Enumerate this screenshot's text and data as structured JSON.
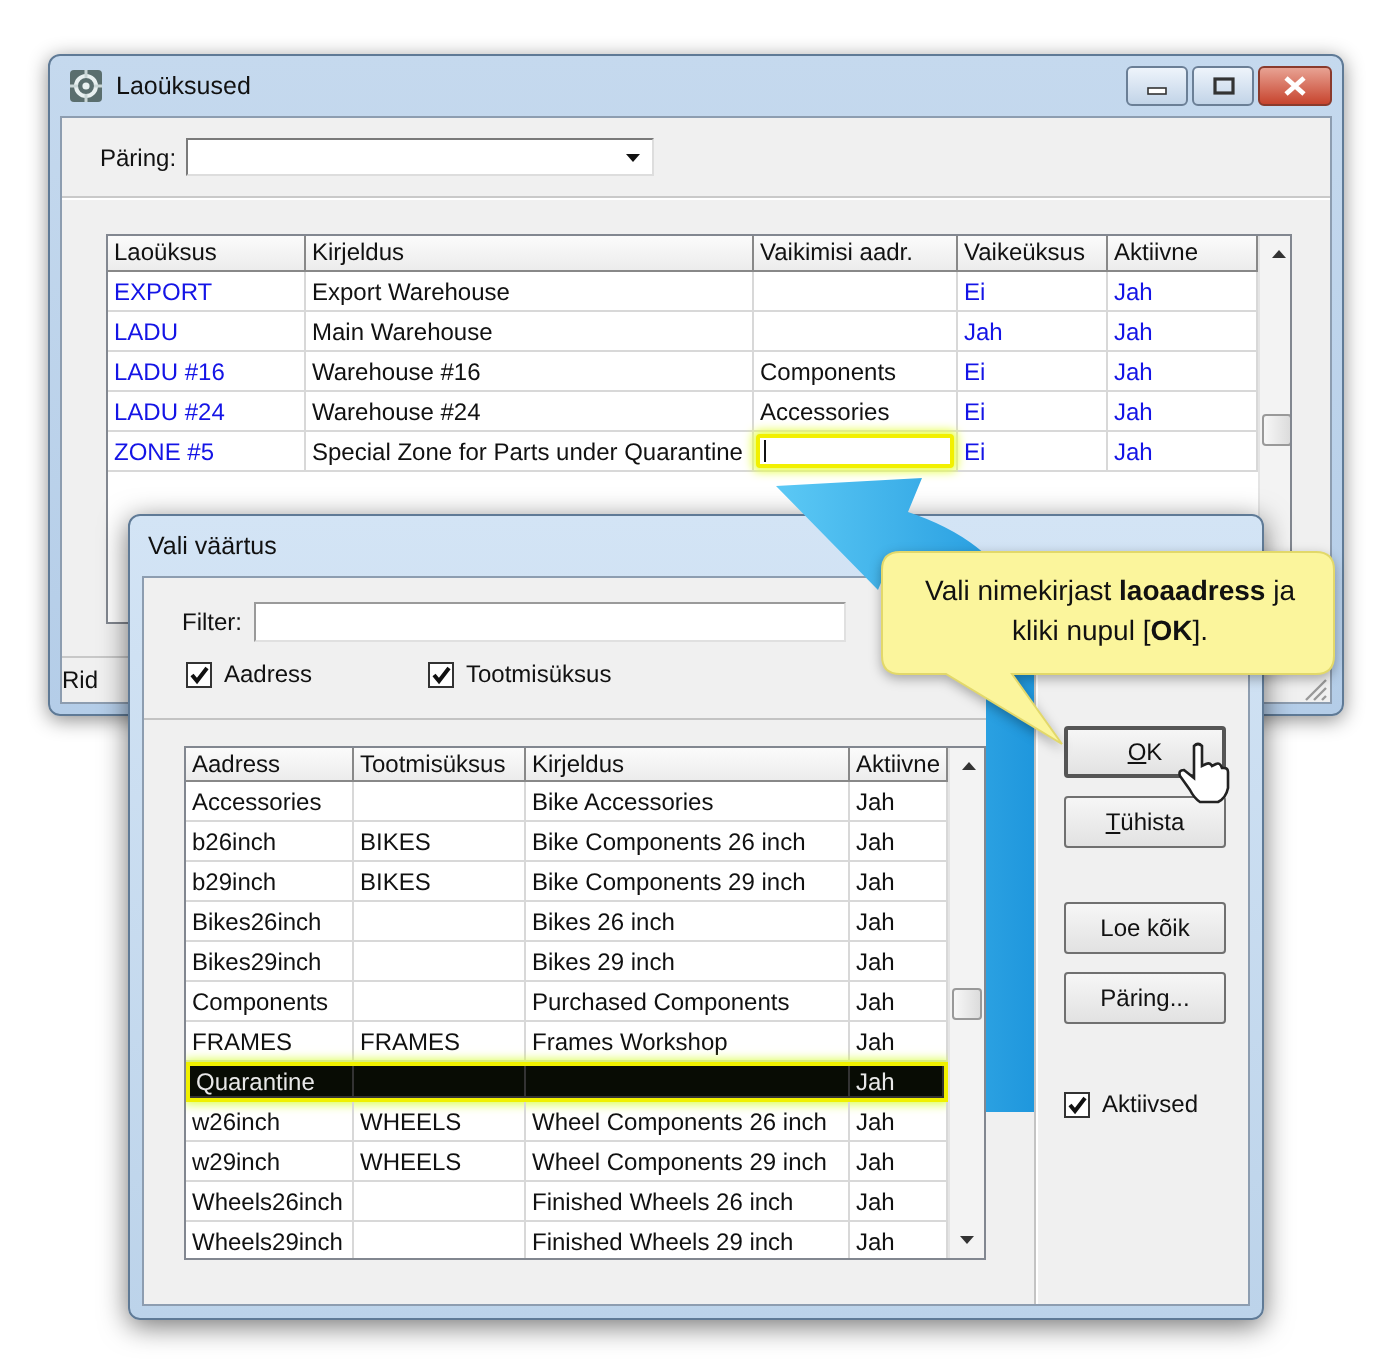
{
  "main_window": {
    "title": "Laoüksused",
    "query": {
      "label": "Päring:"
    },
    "table": {
      "columns": [
        {
          "label": "Laoüksus",
          "kind": "link"
        },
        {
          "label": "Kirjeldus",
          "kind": "text"
        },
        {
          "label": "Vaikimisi aadr.",
          "kind": "field"
        },
        {
          "label": "Vaikeüksus",
          "kind": "link"
        },
        {
          "label": "Aktiivne",
          "kind": "link"
        }
      ],
      "rows": [
        {
          "code": "EXPORT",
          "description": "Export Warehouse",
          "default_unit": "Ei",
          "active": "Jah",
          "editing": false
        },
        {
          "code": "LADU",
          "description": "Main Warehouse",
          "default_unit": "Jah",
          "active": "Jah",
          "editing": false
        },
        {
          "code": "LADU #16",
          "description": "Warehouse #16",
          "default_address": "Components",
          "default_unit": "Ei",
          "active": "Jah",
          "editing": false
        },
        {
          "code": "LADU #24",
          "description": "Warehouse #24",
          "default_address": "Accessories",
          "default_unit": "Ei",
          "active": "Jah",
          "editing": false
        },
        {
          "code": "ZONE #5",
          "description": "Special Zone for Parts under Quarantine",
          "default_unit": "Ei",
          "active": "Jah",
          "editing": true
        }
      ]
    },
    "status_bar": "Rid"
  },
  "dialog": {
    "title": "Vali väärtus",
    "filter": {
      "label": "Filter:"
    },
    "filter_options": [
      {
        "label": "Aadress",
        "checked": true
      },
      {
        "label": "Tootmisüksus",
        "checked": true
      }
    ],
    "table": {
      "columns": [
        {
          "label": "Aadress"
        },
        {
          "label": "Tootmisüksus"
        },
        {
          "label": "Kirjeldus"
        },
        {
          "label": "Aktiivne"
        }
      ],
      "rows": [
        {
          "address": "Accessories",
          "description": "Bike Accessories",
          "active": "Jah",
          "selected": false
        },
        {
          "address": "b26inch",
          "unit": "BIKES",
          "description": "Bike Components 26 inch",
          "active": "Jah",
          "selected": false
        },
        {
          "address": "b29inch",
          "unit": "BIKES",
          "description": "Bike Components 29 inch",
          "active": "Jah",
          "selected": false
        },
        {
          "address": "Bikes26inch",
          "description": "Bikes 26 inch",
          "active": "Jah",
          "selected": false
        },
        {
          "address": "Bikes29inch",
          "description": "Bikes 29 inch",
          "active": "Jah",
          "selected": false
        },
        {
          "address": "Components",
          "description": "Purchased Components",
          "active": "Jah",
          "selected": false
        },
        {
          "address": "FRAMES",
          "unit": "FRAMES",
          "description": "Frames Workshop",
          "active": "Jah",
          "selected": false
        },
        {
          "address": "Quarantine",
          "active": "Jah",
          "selected": true
        },
        {
          "address": "w26inch",
          "unit": "WHEELS",
          "description": "Wheel Components 26 inch",
          "active": "Jah",
          "selected": false
        },
        {
          "address": "w29inch",
          "unit": "WHEELS",
          "description": "Wheel Components 29 inch",
          "active": "Jah",
          "selected": false
        },
        {
          "address": "Wheels26inch",
          "description": "Finished Wheels 26 inch",
          "active": "Jah",
          "selected": false
        },
        {
          "address": "Wheels29inch",
          "description": "Finished Wheels 29 inch",
          "active": "Jah",
          "selected": false
        }
      ]
    },
    "buttons": [
      {
        "label": "OK",
        "mnemonic_first": true,
        "kind": "primary"
      },
      {
        "label": "Tühista",
        "mnemonic_first": true,
        "kind": "action"
      },
      {
        "label": "Loe kõik",
        "mnemonic_first": false,
        "kind": "spaced"
      },
      {
        "label": "Päring...",
        "mnemonic_first": false,
        "kind": "action"
      }
    ],
    "active_only": {
      "label": "Aktiivsed",
      "checked": true
    }
  },
  "callout": {
    "text": "Vali nimekirjast  **laoaadress** ja kliki nupul [**OK**]."
  }
}
